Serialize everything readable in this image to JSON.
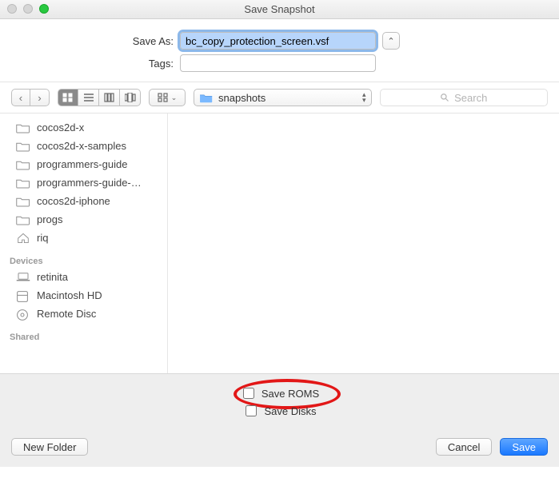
{
  "window": {
    "title": "Save Snapshot"
  },
  "form": {
    "save_as_label": "Save As:",
    "save_as_value": "bc_copy_protection_screen.vsf",
    "tags_label": "Tags:",
    "tags_value": ""
  },
  "toolbar": {
    "location_name": "snapshots",
    "search_placeholder": "Search"
  },
  "sidebar": {
    "favorites": [
      {
        "label": "cocos2d-x",
        "icon": "folder-icon"
      },
      {
        "label": "cocos2d-x-samples",
        "icon": "folder-icon"
      },
      {
        "label": "programmers-guide",
        "icon": "folder-icon"
      },
      {
        "label": "programmers-guide-…",
        "icon": "folder-icon"
      },
      {
        "label": "cocos2d-iphone",
        "icon": "folder-icon"
      },
      {
        "label": "progs",
        "icon": "folder-icon"
      },
      {
        "label": "riq",
        "icon": "home-icon"
      }
    ],
    "devices_heading": "Devices",
    "devices": [
      {
        "label": "retinita",
        "icon": "laptop-icon"
      },
      {
        "label": "Macintosh HD",
        "icon": "disk-icon"
      },
      {
        "label": "Remote Disc",
        "icon": "remote-disc-icon"
      }
    ],
    "shared_heading": "Shared"
  },
  "options": {
    "save_roms_label": "Save ROMS",
    "save_roms_checked": false,
    "save_disks_label": "Save Disks",
    "save_disks_checked": false
  },
  "buttons": {
    "new_folder": "New Folder",
    "cancel": "Cancel",
    "save": "Save"
  }
}
